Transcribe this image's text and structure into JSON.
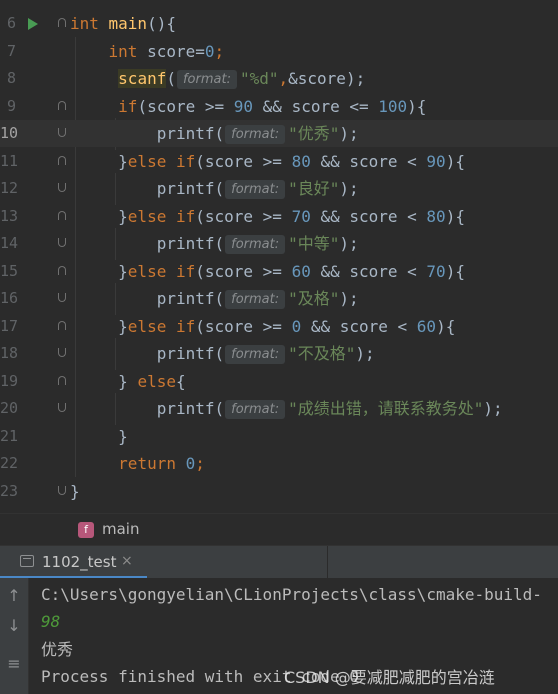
{
  "editor": {
    "lines": [
      {
        "no": "6",
        "parts": [
          [
            "kw",
            "int "
          ],
          [
            "fn",
            "main"
          ],
          [
            "",
            "(){"
          ]
        ]
      },
      {
        "no": "7",
        "parts": [
          [
            "",
            "    "
          ],
          [
            "kw",
            "int "
          ],
          [
            "",
            "score="
          ],
          [
            "num",
            "0"
          ],
          [
            "kw",
            ";"
          ]
        ]
      },
      {
        "no": "8",
        "parts": [
          [
            "",
            "     "
          ],
          [
            "fn",
            "scanf"
          ],
          [
            "",
            "("
          ],
          [
            "hint",
            "format:"
          ],
          [
            "str",
            "\"%d\""
          ],
          [
            "kw",
            ","
          ],
          [
            "",
            "&score);"
          ]
        ]
      },
      {
        "no": "9",
        "parts": [
          [
            "",
            "     "
          ],
          [
            "kw",
            "if"
          ],
          [
            "",
            "(score >= "
          ],
          [
            "num",
            "90"
          ],
          [
            "",
            " && score <= "
          ],
          [
            "num",
            "100"
          ],
          [
            "",
            "){"
          ]
        ]
      },
      {
        "no": "10",
        "parts": [
          [
            "",
            "         printf("
          ],
          [
            "hint",
            "format:"
          ],
          [
            "str",
            "\"优秀\""
          ],
          [
            "",
            ");"
          ]
        ]
      },
      {
        "no": "11",
        "parts": [
          [
            "",
            "     }"
          ],
          [
            "kw",
            "else if"
          ],
          [
            "",
            "(score >= "
          ],
          [
            "num",
            "80"
          ],
          [
            "",
            " && score < "
          ],
          [
            "num",
            "90"
          ],
          [
            "",
            "){"
          ]
        ]
      },
      {
        "no": "12",
        "parts": [
          [
            "",
            "         printf("
          ],
          [
            "hint",
            "format:"
          ],
          [
            "str",
            "\"良好\""
          ],
          [
            "",
            ");"
          ]
        ]
      },
      {
        "no": "13",
        "parts": [
          [
            "",
            "     }"
          ],
          [
            "kw",
            "else if"
          ],
          [
            "",
            "(score >= "
          ],
          [
            "num",
            "70"
          ],
          [
            "",
            " && score < "
          ],
          [
            "num",
            "80"
          ],
          [
            "",
            "){"
          ]
        ]
      },
      {
        "no": "14",
        "parts": [
          [
            "",
            "         printf("
          ],
          [
            "hint",
            "format:"
          ],
          [
            "str",
            "\"中等\""
          ],
          [
            "",
            ");"
          ]
        ]
      },
      {
        "no": "15",
        "parts": [
          [
            "",
            "     }"
          ],
          [
            "kw",
            "else if"
          ],
          [
            "",
            "(score >= "
          ],
          [
            "num",
            "60"
          ],
          [
            "",
            " && score < "
          ],
          [
            "num",
            "70"
          ],
          [
            "",
            "){"
          ]
        ]
      },
      {
        "no": "16",
        "parts": [
          [
            "",
            "         printf("
          ],
          [
            "hint",
            "format:"
          ],
          [
            "str",
            "\"及格\""
          ],
          [
            "",
            ");"
          ]
        ]
      },
      {
        "no": "17",
        "parts": [
          [
            "",
            "     }"
          ],
          [
            "kw",
            "else if"
          ],
          [
            "",
            "(score >= "
          ],
          [
            "num",
            "0"
          ],
          [
            "",
            " && score < "
          ],
          [
            "num",
            "60"
          ],
          [
            "",
            "){"
          ]
        ]
      },
      {
        "no": "18",
        "parts": [
          [
            "",
            "         printf("
          ],
          [
            "hint",
            "format:"
          ],
          [
            "str",
            "\"不及格\""
          ],
          [
            "",
            ");"
          ]
        ]
      },
      {
        "no": "19",
        "parts": [
          [
            "",
            "     } "
          ],
          [
            "kw",
            "else"
          ],
          [
            "",
            "{"
          ]
        ]
      },
      {
        "no": "20",
        "parts": [
          [
            "",
            "         printf("
          ],
          [
            "hint",
            "format:"
          ],
          [
            "str",
            "\"成绩出错，请联系教务处\""
          ],
          [
            "",
            ");"
          ]
        ]
      },
      {
        "no": "21",
        "parts": [
          [
            "",
            "     }"
          ]
        ]
      },
      {
        "no": "22",
        "parts": [
          [
            "",
            "     "
          ],
          [
            "kw",
            "return "
          ],
          [
            "num",
            "0"
          ],
          [
            "kw",
            ";"
          ]
        ]
      },
      {
        "no": "23",
        "parts": [
          [
            "",
            "}"
          ]
        ]
      }
    ]
  },
  "breadcrumb": {
    "badge": "f",
    "label": "main"
  },
  "run_panel": {
    "tab_label": "1102_test",
    "close_glyph": "×",
    "console_lines": [
      {
        "text": "C:\\Users\\gongyelian\\CLionProjects\\class\\cmake-build-",
        "kind": "path"
      },
      {
        "text": "98",
        "kind": "input"
      },
      {
        "text": "优秀",
        "kind": "output"
      },
      {
        "text": "Process finished with exit code 0",
        "kind": "status"
      }
    ]
  },
  "watermark": "CSDN @要减肥减肥的宫冶涟",
  "icons": {
    "run": "run-icon",
    "up": "arrow-up-icon",
    "down": "arrow-down-icon",
    "wrap": "soft-wrap-icon"
  },
  "colors": {
    "keyword": "#cc7832",
    "function": "#ffc66d",
    "number": "#6897bb",
    "string": "#6a8759",
    "text": "#a9b7c6",
    "input": "#4e9a3a",
    "tab_underline": "#4a88c7"
  }
}
